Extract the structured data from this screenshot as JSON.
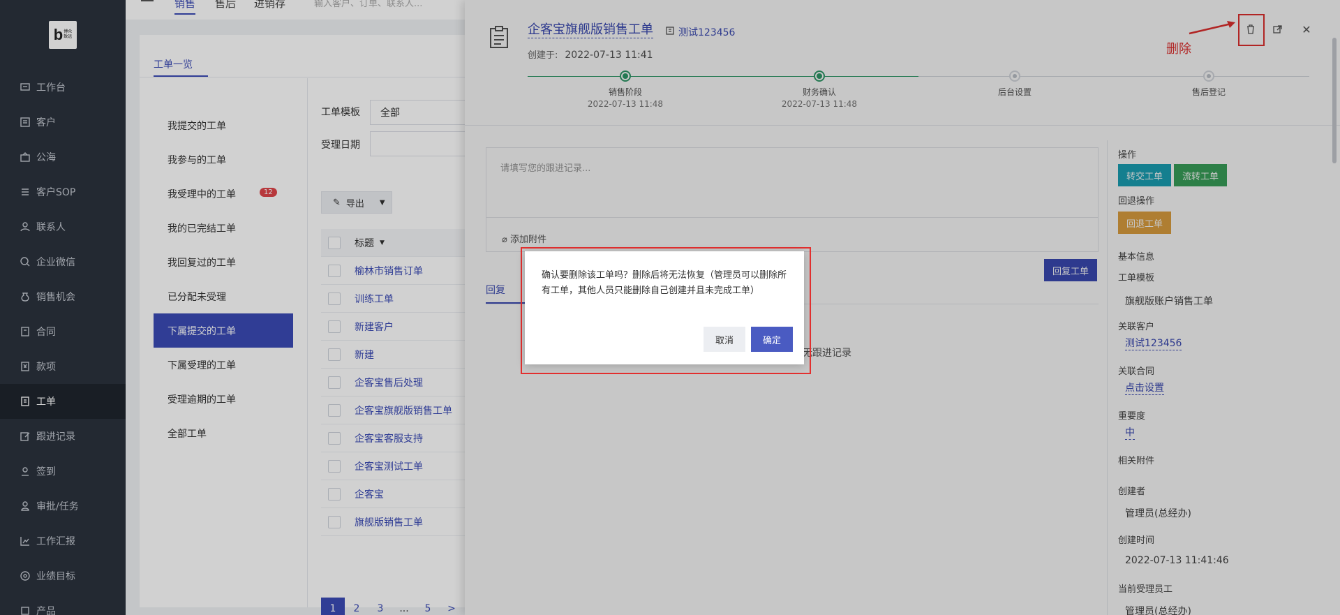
{
  "sidebar": {
    "logo_letter": "b",
    "logo_text": "博众\n致远",
    "items": [
      {
        "label": "工作台",
        "icon": "workbench-icon"
      },
      {
        "label": "客户",
        "icon": "customer-icon"
      },
      {
        "label": "公海",
        "icon": "sea-icon"
      },
      {
        "label": "客户SOP",
        "icon": "sop-icon"
      },
      {
        "label": "联系人",
        "icon": "contact-icon"
      },
      {
        "label": "企业微信",
        "icon": "wechat-icon"
      },
      {
        "label": "销售机会",
        "icon": "money-bag-icon"
      },
      {
        "label": "合同",
        "icon": "contract-icon"
      },
      {
        "label": "款项",
        "icon": "payment-icon"
      },
      {
        "label": "工单",
        "icon": "ticket-icon",
        "active": true
      },
      {
        "label": "跟进记录",
        "icon": "edit-icon"
      },
      {
        "label": "签到",
        "icon": "checkin-icon"
      },
      {
        "label": "审批/任务",
        "icon": "approval-icon"
      },
      {
        "label": "工作汇报",
        "icon": "report-icon"
      },
      {
        "label": "业绩目标",
        "icon": "target-icon"
      },
      {
        "label": "产品",
        "icon": "product-icon"
      }
    ]
  },
  "topbar": {
    "tabs": [
      "销售",
      "售后",
      "进销存"
    ],
    "search_placeholder": "输入客户、订单、联系人..."
  },
  "list_page": {
    "tab_label": "工单一览",
    "menu": [
      {
        "label": "我提交的工单"
      },
      {
        "label": "我参与的工单"
      },
      {
        "label": "我受理中的工单",
        "badge": "12"
      },
      {
        "label": "我的已完结工单"
      },
      {
        "label": "我回复过的工单"
      },
      {
        "label": "已分配未受理"
      },
      {
        "label": "下属提交的工单",
        "active": true
      },
      {
        "label": "下属受理的工单"
      },
      {
        "label": "受理逾期的工单"
      },
      {
        "label": "全部工单"
      }
    ],
    "filter_template_label": "工单模板",
    "filter_template_value": "全部",
    "filter_date_label": "受理日期",
    "export_label": "导出",
    "column_title": "标题",
    "rows": [
      "榆林市销售订单",
      "训练工单",
      "新建客户",
      "新建",
      "企客宝售后处理",
      "企客宝旗舰版销售工单",
      "企客宝客服支持",
      "企客宝测试工单",
      "企客宝",
      "旗舰版销售工单"
    ],
    "pager": [
      "1",
      "2",
      "3",
      "...",
      "5",
      ">"
    ]
  },
  "drawer": {
    "title": "企客宝旗舰版销售工单",
    "client": "测试123456",
    "created_label": "创建于:",
    "created_value": "2022-07-13 11:41",
    "steps": [
      {
        "name": "销售阶段",
        "time": "2022-07-13 11:48",
        "done": true
      },
      {
        "name": "财务确认",
        "time": "2022-07-13 11:48",
        "done": true
      },
      {
        "name": "后台设置",
        "time": "",
        "done": false
      },
      {
        "name": "售后登记",
        "time": "",
        "done": false
      }
    ],
    "annotation_delete": "删除",
    "annotation_color": "#e3302f",
    "follow_placeholder": "请填写您的跟进记录...",
    "attach_label": "添加附件",
    "reply_button": "回复工单",
    "reply_tab": "回复",
    "empty_text": "暂无跟进记录",
    "side": {
      "ops_label": "操作",
      "transfer_btn": "转交工单",
      "flow_btn": "流转工单",
      "rollback_label": "回退操作",
      "rollback_btn": "回退工单",
      "basic_info": "基本信息",
      "template_label": "工单模板",
      "template_value": "旗舰版账户销售工单",
      "customer_label": "关联客户",
      "customer_value": "测试123456",
      "contract_label": "关联合同",
      "contract_value": "点击设置",
      "priority_label": "重要度",
      "priority_value": "中",
      "attach_label": "相关附件",
      "creator_label": "创建者",
      "creator_value": "管理员(总经办)",
      "created_label": "创建时间",
      "created_value": "2022-07-13 11:41:46",
      "assignee_label": "当前受理员工",
      "assignee_value": "管理员(总经办)"
    }
  },
  "dialog": {
    "message": "确认要删除该工单吗？删除后将无法恢复（管理员可以删除所有工单，其他人员只能删除自己创建并且未完成工单）",
    "cancel": "取消",
    "confirm": "确定"
  },
  "colors": {
    "primary": "#3b4bb6",
    "teal": "#1aa3b8",
    "green": "#3aa35c",
    "orange": "#e0a240",
    "sidebar_bg": "#2b323d",
    "annotation_red": "#e3302f"
  }
}
